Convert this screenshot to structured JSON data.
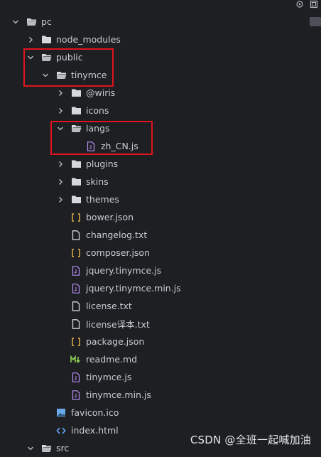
{
  "toolbar": {
    "icons": [
      "locate-icon",
      "collapse-icon"
    ]
  },
  "tree": [
    {
      "label": "pc",
      "indent": 0,
      "kind": "folder",
      "expanded": true
    },
    {
      "label": "node_modules",
      "indent": 1,
      "kind": "folder",
      "expanded": false
    },
    {
      "label": "public",
      "indent": 1,
      "kind": "folder",
      "expanded": true
    },
    {
      "label": "tinymce",
      "indent": 2,
      "kind": "folder",
      "expanded": true
    },
    {
      "label": "@wiris",
      "indent": 3,
      "kind": "folder",
      "expanded": false
    },
    {
      "label": "icons",
      "indent": 3,
      "kind": "folder",
      "expanded": false
    },
    {
      "label": "langs",
      "indent": 3,
      "kind": "folder",
      "expanded": true
    },
    {
      "label": "zh_CN.js",
      "indent": 4,
      "kind": "js"
    },
    {
      "label": "plugins",
      "indent": 3,
      "kind": "folder",
      "expanded": false
    },
    {
      "label": "skins",
      "indent": 3,
      "kind": "folder",
      "expanded": false
    },
    {
      "label": "themes",
      "indent": 3,
      "kind": "folder",
      "expanded": false
    },
    {
      "label": "bower.json",
      "indent": 3,
      "kind": "json"
    },
    {
      "label": "changelog.txt",
      "indent": 3,
      "kind": "txt"
    },
    {
      "label": "composer.json",
      "indent": 3,
      "kind": "json"
    },
    {
      "label": "jquery.tinymce.js",
      "indent": 3,
      "kind": "js"
    },
    {
      "label": "jquery.tinymce.min.js",
      "indent": 3,
      "kind": "js"
    },
    {
      "label": "license.txt",
      "indent": 3,
      "kind": "txt"
    },
    {
      "label": "license译本.txt",
      "indent": 3,
      "kind": "txt"
    },
    {
      "label": "package.json",
      "indent": 3,
      "kind": "json"
    },
    {
      "label": "readme.md",
      "indent": 3,
      "kind": "md"
    },
    {
      "label": "tinymce.js",
      "indent": 3,
      "kind": "js"
    },
    {
      "label": "tinymce.min.js",
      "indent": 3,
      "kind": "js"
    },
    {
      "label": "favicon.ico",
      "indent": 2,
      "kind": "image"
    },
    {
      "label": "index.html",
      "indent": 2,
      "kind": "html"
    },
    {
      "label": "src",
      "indent": 1,
      "kind": "folder",
      "expanded": true
    }
  ],
  "watermark": "CSDN @全班一起喊加油",
  "colors": {
    "background": "#1e1f22",
    "text": "#c9ccd3",
    "folder": "#d7d8dd",
    "json": "#e8b647",
    "js": "#b58ff5",
    "md_accent": "#8fd15a",
    "html": "#66a9ff",
    "image": "#6aa7e6",
    "highlight": "#e0141e"
  }
}
